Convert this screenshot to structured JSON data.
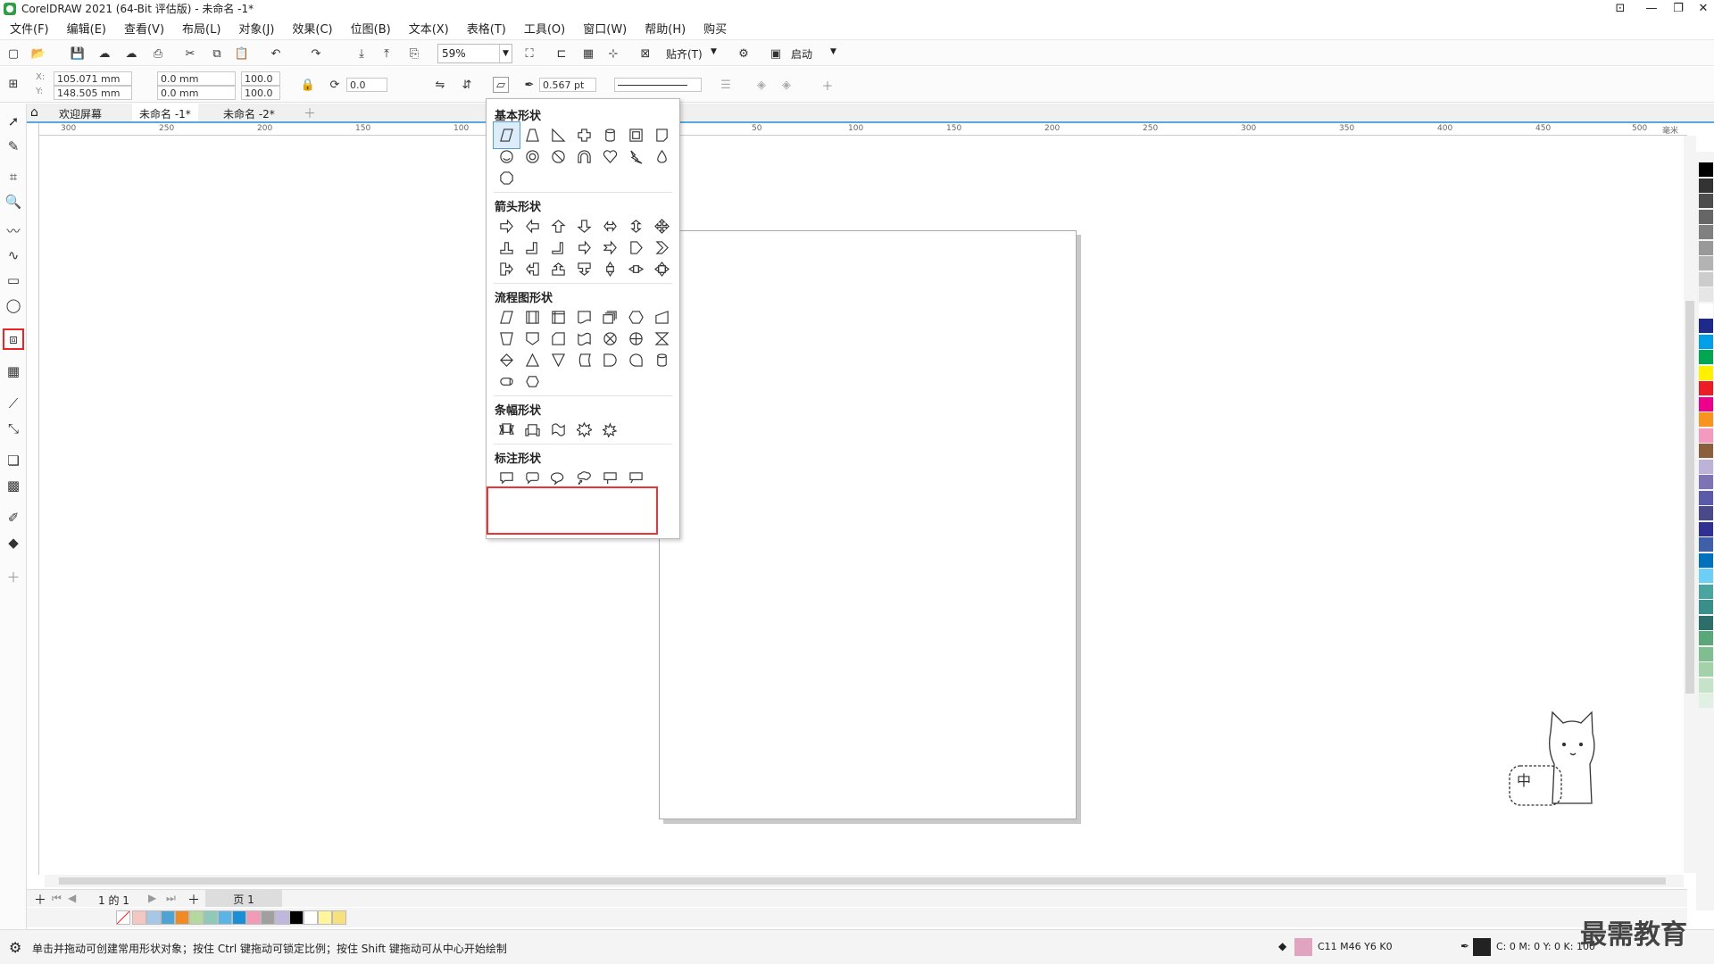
{
  "window": {
    "title": "CorelDRAW 2021 (64-Bit 评估版) - 未命名 -1*"
  },
  "menu": [
    "文件(F)",
    "编辑(E)",
    "查看(V)",
    "布局(L)",
    "对象(J)",
    "效果(C)",
    "位图(B)",
    "文本(X)",
    "表格(T)",
    "工具(O)",
    "窗口(W)",
    "帮助(H)",
    "购买"
  ],
  "toolbar": {
    "zoom": "59%",
    "snap_label": "贴齐(T)",
    "launch_label": "启动"
  },
  "property_bar": {
    "x": "105.071 mm",
    "y": "148.505 mm",
    "w": "0.0 mm",
    "h": "0.0 mm",
    "sx": "100.0",
    "sy": "100.0",
    "angle": "0.0",
    "outline": "0.567 pt"
  },
  "tabs": [
    {
      "label": "欢迎屏幕"
    },
    {
      "label": "未命名 -1*"
    },
    {
      "label": "未命名 -2*"
    }
  ],
  "ruler_ticks": [
    "300",
    "250",
    "200",
    "150",
    "100",
    "50",
    "100",
    "150",
    "200",
    "250",
    "300",
    "350",
    "400",
    "450",
    "500",
    "毫米"
  ],
  "shapes_dropdown": {
    "basic_title": "基本形状",
    "arrow_title": "箭头形状",
    "flow_title": "流程图形状",
    "banner_title": "条幅形状",
    "callout_title": "标注形状"
  },
  "page_nav": {
    "pages": "1 的 1",
    "page_tab": "页 1"
  },
  "status": {
    "hint": "单击并拖动可创建常用形状对象；按住 Ctrl 键拖动可锁定比例；按住 Shift 键拖动可从中心开始绘制",
    "fill_label": "C11 M46 Y6 K0",
    "outline_label": "C: 0 M: 0 Y: 0 K: 100"
  },
  "watermark": "最需教育",
  "colors": {
    "accent": "#59a7e0",
    "highlight": "#e33333",
    "fill": "#e0a3c0"
  },
  "bottom_palette": [
    "#f4c7c3",
    "#a7c7e7",
    "#4da3d4",
    "#f08a24",
    "#b5d99c",
    "#8fc9b9",
    "#5ab4e5",
    "#1a8fd6",
    "#f39ab6",
    "#a0a0a0",
    "#c0b8dc",
    "#000000",
    "#ffffff",
    "#fff59d",
    "#f9e07f"
  ],
  "right_palette": [
    "#000000",
    "#333333",
    "#4d4d4d",
    "#666666",
    "#808080",
    "#999999",
    "#b3b3b3",
    "#cccccc",
    "#e6e6e6",
    "#ffffff",
    "#1d2a8c",
    "#00a0e9",
    "#00a651",
    "#fff200",
    "#ed1c24",
    "#ec008c",
    "#f7941d",
    "#f49ac1",
    "#8b5e3c",
    "#bdb3d9",
    "#7e74b5",
    "#5a5aa8",
    "#4a4a8a",
    "#2e3192",
    "#3f5fa8",
    "#0072bc",
    "#6dcff6",
    "#4aa5a0",
    "#3a8f8a",
    "#2b6e6a",
    "#5aa77a",
    "#7fbf8f",
    "#a3d2a8",
    "#c5e3c8",
    "#e0f0e2"
  ]
}
